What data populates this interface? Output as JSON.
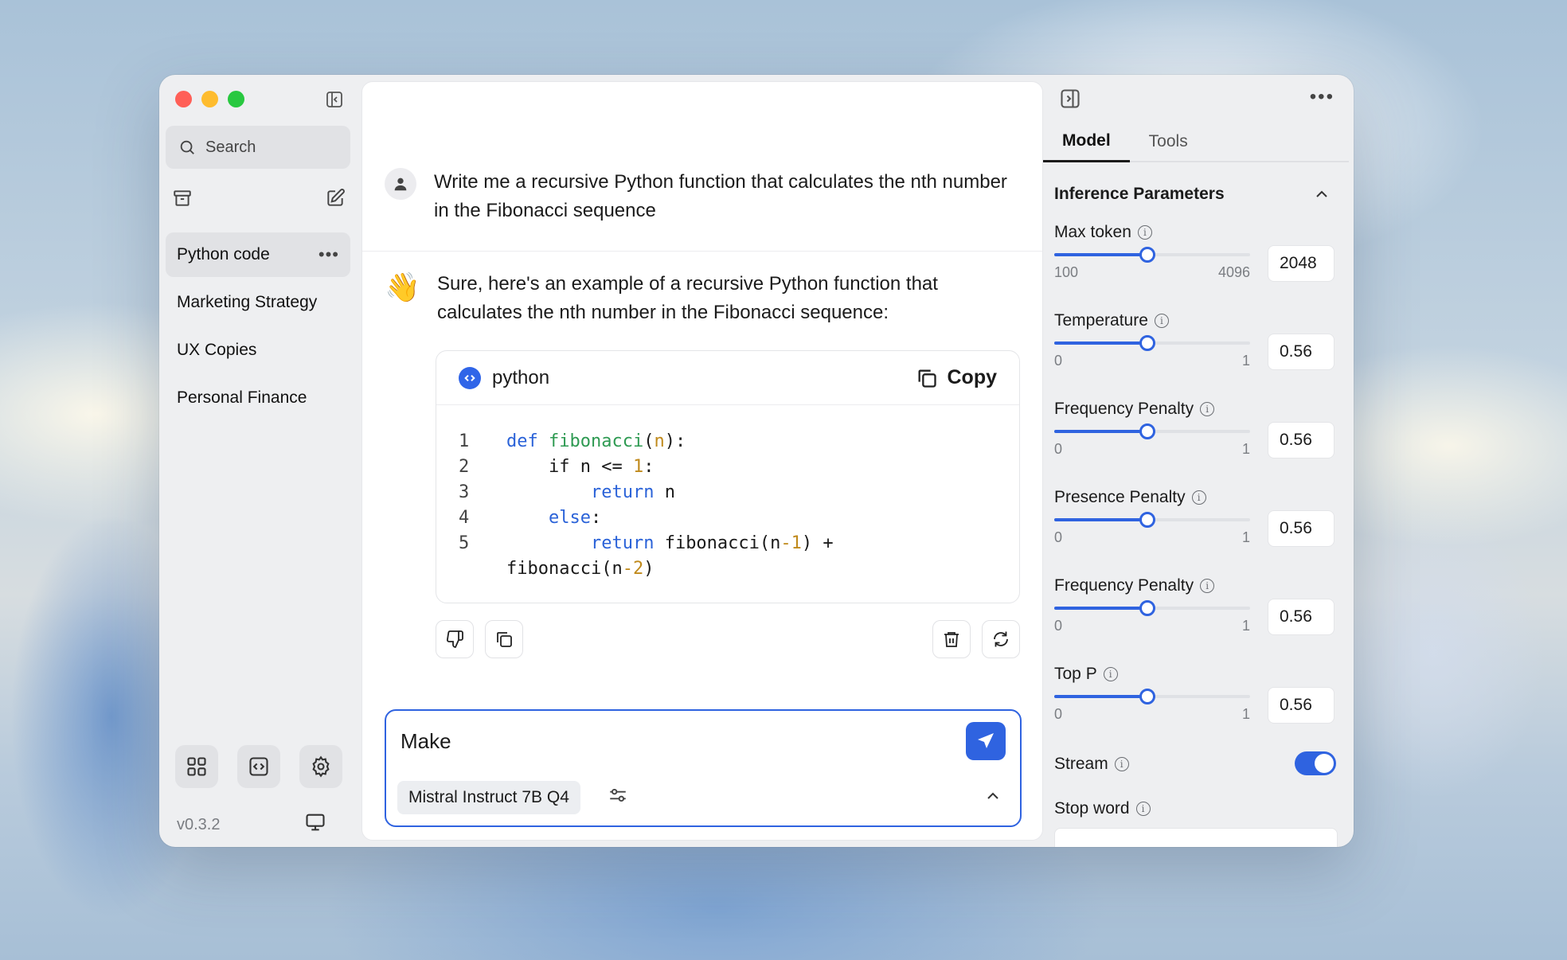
{
  "sidebar": {
    "search_placeholder": "Search",
    "threads": [
      {
        "title": "Python code",
        "active": true
      },
      {
        "title": "Marketing Strategy"
      },
      {
        "title": "UX Copies"
      },
      {
        "title": "Personal Finance"
      }
    ],
    "more_label": "•••",
    "version": "v0.3.2"
  },
  "chat": {
    "user_message": "Write me a recursive Python function that calculates the nth number in the Fibonacci sequence",
    "assistant_emoji": "👋",
    "assistant_message": "Sure, here's an example of a recursive Python function that calculates the nth number in the Fibonacci sequence:",
    "code": {
      "language": "python",
      "copy_label": "Copy",
      "line_numbers": [
        "1",
        "2",
        "3",
        "4",
        "5"
      ]
    },
    "composer": {
      "input_value": "Make",
      "model": "Mistral Instruct 7B Q4"
    }
  },
  "right_panel": {
    "tabs": [
      {
        "label": "Model",
        "active": true
      },
      {
        "label": "Tools"
      }
    ],
    "section_title": "Inference Parameters",
    "params": [
      {
        "label": "Max token",
        "min": "100",
        "max": "4096",
        "value": "2048",
        "fraction": 0.476
      },
      {
        "label": "Temperature",
        "min": "0",
        "max": "1",
        "value": "0.56",
        "fraction": 0.476
      },
      {
        "label": "Frequency Penalty",
        "min": "0",
        "max": "1",
        "value": "0.56",
        "fraction": 0.476
      },
      {
        "label": "Presence Penalty",
        "min": "0",
        "max": "1",
        "value": "0.56",
        "fraction": 0.476
      },
      {
        "label": "Frequency Penalty",
        "min": "0",
        "max": "1",
        "value": "0.56",
        "fraction": 0.476
      },
      {
        "label": "Top P",
        "min": "0",
        "max": "1",
        "value": "0.56",
        "fraction": 0.476
      }
    ],
    "stream_label": "Stream",
    "stream_enabled": true,
    "stop_word_label": "Stop word"
  },
  "colors": {
    "accent": "#2f63e0",
    "close": "#ff5f57",
    "minimize": "#febc2e",
    "maximize": "#28c840"
  }
}
